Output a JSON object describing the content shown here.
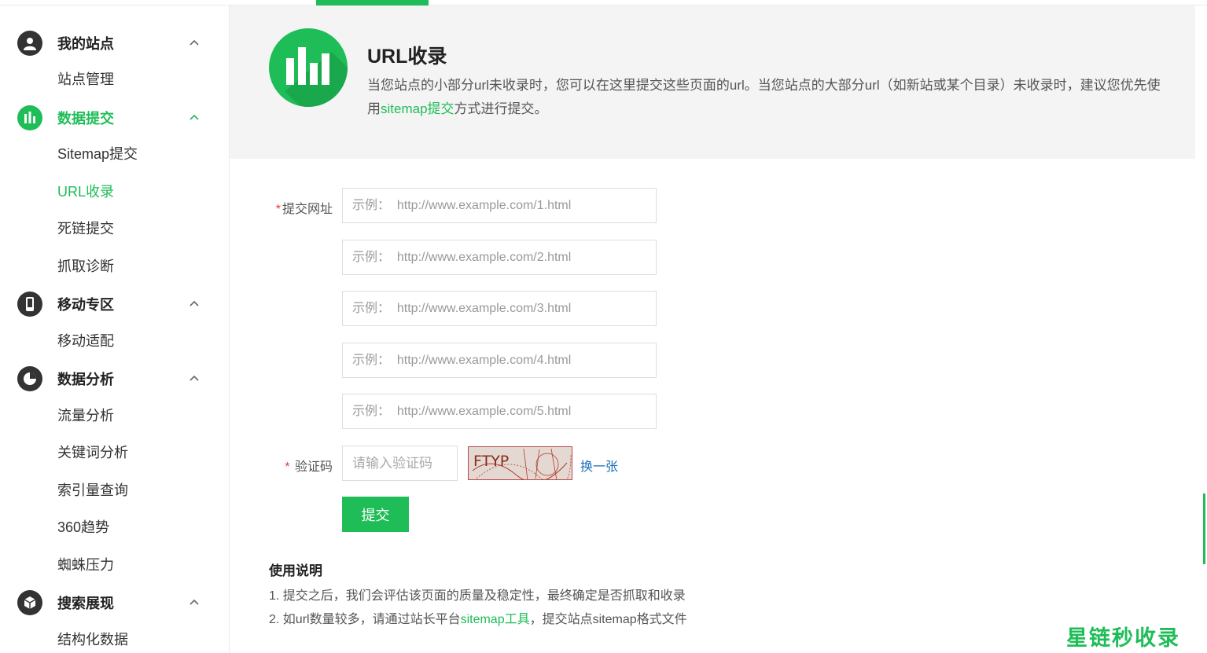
{
  "sidebar": {
    "groups": [
      {
        "label": "我的站点",
        "icon": "user-icon",
        "items": [
          "站点管理"
        ]
      },
      {
        "label": "数据提交",
        "icon": "bar-chart-icon",
        "items": [
          "Sitemap提交",
          "URL收录",
          "死链提交",
          "抓取诊断"
        ]
      },
      {
        "label": "移动专区",
        "icon": "mobile-icon",
        "items": [
          "移动适配"
        ]
      },
      {
        "label": "数据分析",
        "icon": "pie-chart-icon",
        "items": [
          "流量分析",
          "关键词分析",
          "索引量查询",
          "360趋势",
          "蜘蛛压力"
        ]
      },
      {
        "label": "搜索展现",
        "icon": "cube-icon",
        "items": [
          "结构化数据"
        ]
      }
    ],
    "active_group": "数据提交",
    "active_item": "URL收录"
  },
  "banner": {
    "title": "URL收录",
    "desc_before": "当您站点的小部分url未收录时，您可以在这里提交这些页面的url。当您站点的大部分url（如新站或某个目录）未收录时，建议您优先使用",
    "desc_link": "sitemap提交",
    "desc_after": "方式进行提交。",
    "icon": "bar-chart-icon"
  },
  "form": {
    "required_mark": "*",
    "url_label": "提交网址",
    "url_placeholders": [
      "示例：  http://www.example.com/1.html",
      "示例：  http://www.example.com/2.html",
      "示例：  http://www.example.com/3.html",
      "示例：  http://www.example.com/4.html",
      "示例：  http://www.example.com/5.html"
    ],
    "captcha_label": "验证码",
    "captcha_placeholder": "请输入验证码",
    "captcha_text": "FTYP",
    "refresh_label": "换一张",
    "submit_label": "提交"
  },
  "usage": {
    "title": "使用说明",
    "line1": "1. 提交之后，我们会评估该页面的质量及稳定性，最终确定是否抓取和收录",
    "line2_before": "2. 如url数量较多，请通过站长平台",
    "line2_link": "sitemap工具",
    "line2_after": "，提交站点sitemap格式文件"
  },
  "watermark": "星链秒收录",
  "colors": {
    "accent": "#1fbd58",
    "link": "#1a6fb8",
    "required": "#e4393c"
  }
}
